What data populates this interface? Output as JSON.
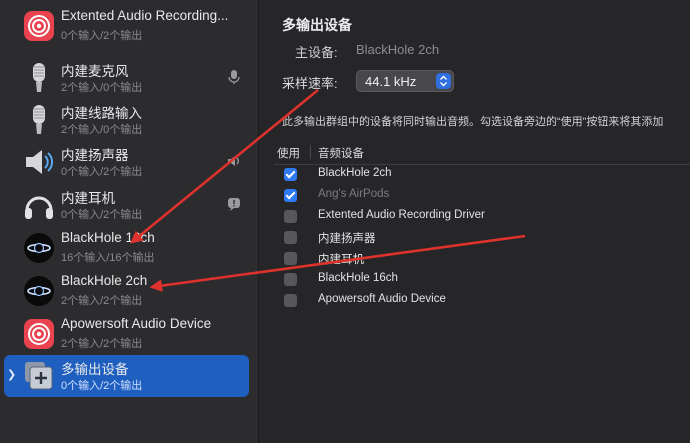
{
  "sidebar": {
    "devices": [
      {
        "name": "Extented Audio Recording...",
        "sub": "0个输入/2个输出",
        "icon": "red-speaker"
      },
      {
        "name": "内建麦克风",
        "sub": "2个输入/0个输出",
        "icon": "mic"
      },
      {
        "name": "内建线路输入",
        "sub": "2个输入/0个输出",
        "icon": "mic"
      },
      {
        "name": "内建扬声器",
        "sub": "0个输入/2个输出",
        "icon": "speaker"
      },
      {
        "name": "内建耳机",
        "sub": "0个输入/2个输出",
        "icon": "headphones"
      },
      {
        "name": "BlackHole 16ch",
        "sub": "16个输入/16个输出",
        "icon": "blackhole"
      },
      {
        "name": "BlackHole 2ch",
        "sub": "2个输入/2个输出",
        "icon": "blackhole"
      },
      {
        "name": "Apowersoft Audio Device",
        "sub": "2个输入/2个输出",
        "icon": "red-speaker"
      },
      {
        "name": "多输出设备",
        "sub": "0个输入/2个输出",
        "icon": "multi-output",
        "selected": true
      }
    ]
  },
  "main": {
    "title": "多输出设备",
    "master_label": "主设备:",
    "master_value": "BlackHole 2ch",
    "rate_label": "采样速率:",
    "rate_value": "44.1 kHz",
    "description": "此多输出群组中的设备将同时输出音频。勾选设备旁边的“使用”按钮来将其添加",
    "columns": {
      "use": "使用",
      "device": "音频设备"
    },
    "rows": [
      {
        "label": "BlackHole 2ch",
        "checked": true,
        "dim": false
      },
      {
        "label": "Ang's AirPods",
        "checked": true,
        "dim": true
      },
      {
        "label": "Extented Audio Recording Driver",
        "checked": false,
        "dim": false
      },
      {
        "label": "内建扬声器",
        "checked": false,
        "dim": false
      },
      {
        "label": "内建耳机",
        "checked": false,
        "dim": false
      },
      {
        "label": "BlackHole 16ch",
        "checked": false,
        "dim": false
      },
      {
        "label": "Apowersoft Audio Device",
        "checked": false,
        "dim": false
      }
    ]
  },
  "colors": {
    "selection": "#1f5fbf",
    "checkbox_on": "#2f7af3",
    "annotation_arrow": "#e0322d"
  }
}
